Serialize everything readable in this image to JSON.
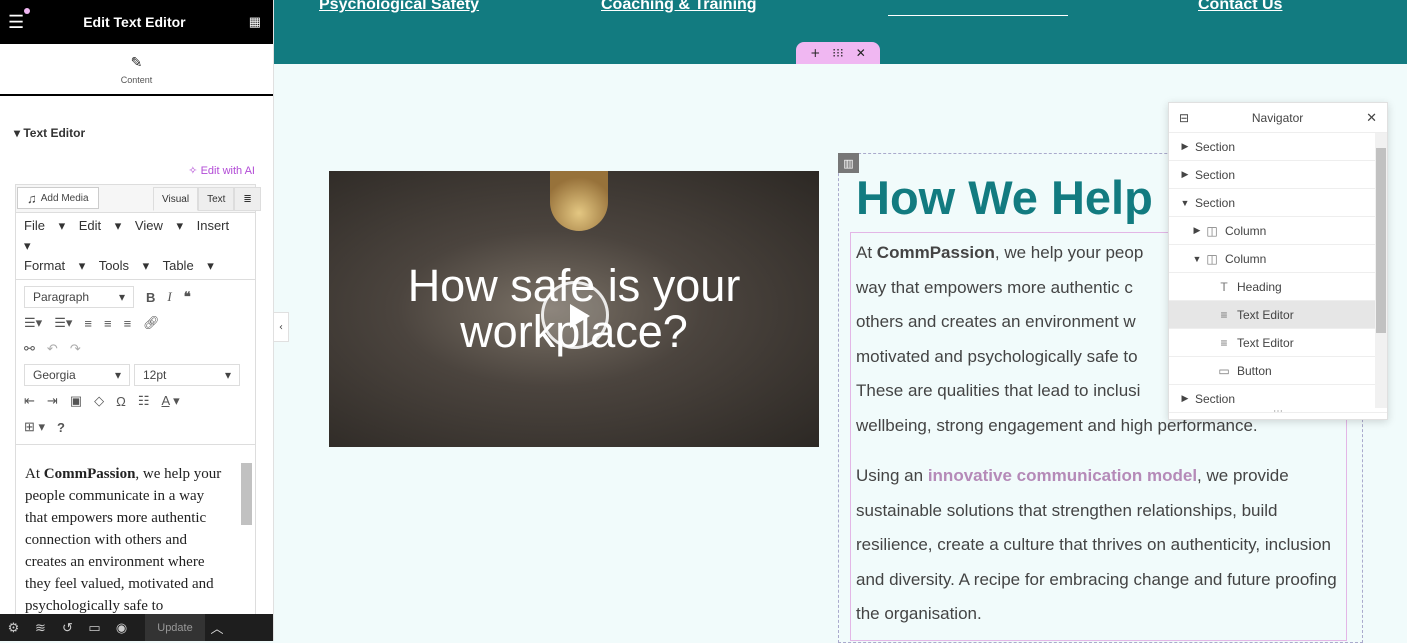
{
  "sidebar": {
    "title": "Edit Text Editor",
    "content_tab": "Content",
    "section_title": "Text Editor",
    "edit_with_ai": "Edit with AI",
    "add_media": "Add Media",
    "tab_visual": "Visual",
    "tab_text": "Text",
    "menus": [
      "File",
      "Edit",
      "View",
      "Insert",
      "Format",
      "Tools",
      "Table"
    ],
    "paragraph_select": "Paragraph",
    "font_select": "Georgia",
    "size_select": "12pt",
    "editor": {
      "before": "At ",
      "bold": "CommPassion",
      "after": ", we help your people communicate in a way that empowers more authentic connection with others and creates an environment where they feel valued, motivated and psychologically safe to"
    },
    "bottom_update": "Update"
  },
  "top_nav": [
    "Psychological Safety",
    "Coaching & Training",
    "",
    "Contact Us"
  ],
  "video": {
    "title_line1": "How safe is your",
    "title_line2": "workplace?"
  },
  "main": {
    "heading": "How We Help",
    "p1_before": "At ",
    "p1_bold": "CommPassion",
    "p1_line1": ", we help your peop",
    "p1_line2": "way that empowers more authentic c",
    "p1_line3": "others and creates an environment w",
    "p1_line4": "motivated and psychologically safe to",
    "p1_line5": "These are qualities that lead to inclusi",
    "p1_line6": "wellbeing, strong engagement and high performance.",
    "p2_before": "Using an ",
    "p2_link": "innovative communication model",
    "p2_after": ", we provide sustainable solutions that strengthen relationships, build resilience, create a culture that thrives on authenticity, inclusion and diversity. A recipe for embracing change and future proofing the organisation."
  },
  "navigator": {
    "title": "Navigator",
    "items": [
      {
        "label": "Section",
        "level": 0,
        "arrow": "right"
      },
      {
        "label": "Section",
        "level": 0,
        "arrow": "right"
      },
      {
        "label": "Section",
        "level": 0,
        "arrow": "down"
      },
      {
        "label": "Column",
        "level": 1,
        "arrow": "right"
      },
      {
        "label": "Column",
        "level": 1,
        "arrow": "down"
      },
      {
        "label": "Heading",
        "level": 2,
        "arrow": "none"
      },
      {
        "label": "Text Editor",
        "level": 2,
        "arrow": "none",
        "selected": true
      },
      {
        "label": "Text Editor",
        "level": 2,
        "arrow": "none"
      },
      {
        "label": "Button",
        "level": 2,
        "arrow": "none"
      },
      {
        "label": "Section",
        "level": 0,
        "arrow": "right"
      }
    ]
  },
  "colors": {
    "teal": "#127b80",
    "accent_pink": "#f0b7f2",
    "link_mauve": "#b58ab8",
    "ai_purple": "#b24bd6"
  }
}
